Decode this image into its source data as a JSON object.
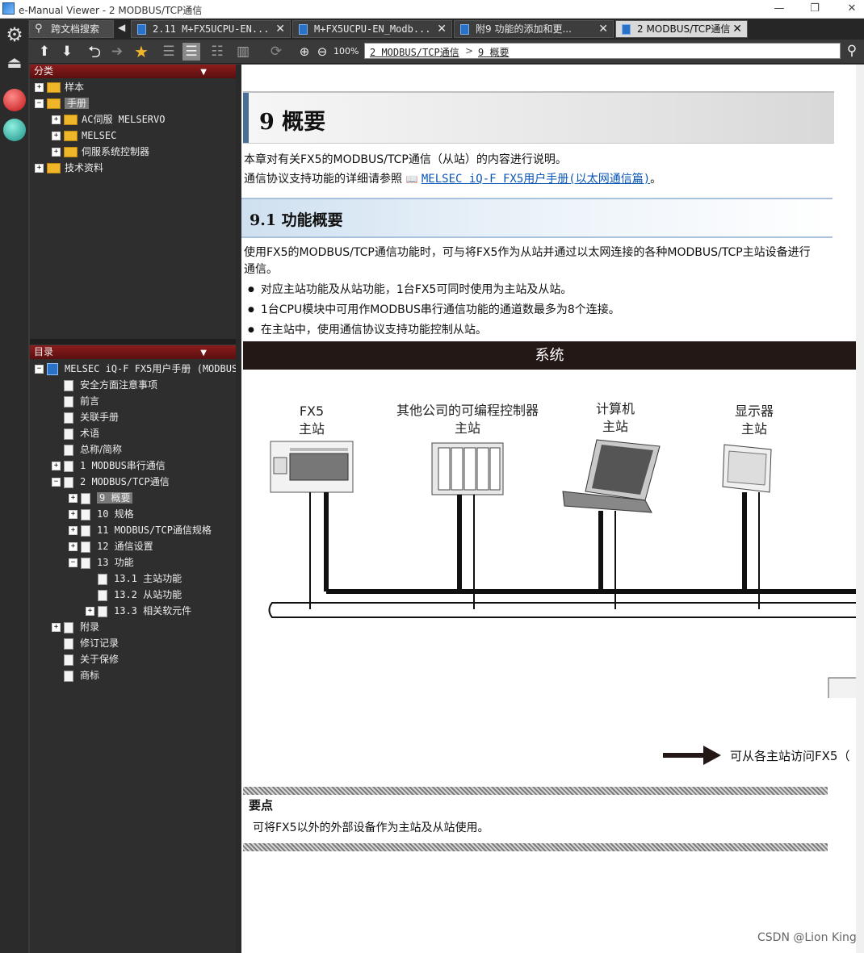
{
  "window": {
    "title": "e-Manual Viewer - 2 MODBUS/TCP通信",
    "min": "—",
    "max": "❐",
    "close": "✕"
  },
  "tabs": [
    {
      "label": "跨文档搜索"
    },
    {
      "label": "2.11 M+FX5UCPU-EN..."
    },
    {
      "label": "M+FX5UCPU-EN_Modb..."
    },
    {
      "label": "附9 功能的添加和更..."
    },
    {
      "label": "2 MODBUS/TCP通信"
    }
  ],
  "toolbar": {
    "zoom": "100%",
    "breadcrumb": [
      "2 MODBUS/TCP通信",
      ">",
      "9 概要"
    ]
  },
  "category_panel": {
    "title": "分类",
    "items": [
      {
        "label": "样本",
        "expander": "+"
      },
      {
        "label": "手册",
        "expander": "−"
      },
      {
        "label": "AC伺服 MELSERVO",
        "expander": "+"
      },
      {
        "label": "MELSEC",
        "expander": "+"
      },
      {
        "label": "伺服系统控制器",
        "expander": "+"
      },
      {
        "label": "技术资料",
        "expander": "+"
      }
    ]
  },
  "toc_panel": {
    "title": "目录",
    "items": [
      {
        "label": "MELSEC iQ-F FX5用户手册 (MODBUS",
        "expander": "−"
      },
      {
        "label": "安全方面注意事项"
      },
      {
        "label": "前言"
      },
      {
        "label": "关联手册"
      },
      {
        "label": "术语"
      },
      {
        "label": "总称/简称"
      },
      {
        "label": "1 MODBUS串行通信",
        "expander": "+"
      },
      {
        "label": "2 MODBUS/TCP通信",
        "expander": "−"
      },
      {
        "label": "9 概要",
        "expander": "+"
      },
      {
        "label": "10 规格",
        "expander": "+"
      },
      {
        "label": "11 MODBUS/TCP通信规格",
        "expander": "+"
      },
      {
        "label": "12 通信设置",
        "expander": "+"
      },
      {
        "label": "13 功能",
        "expander": "−"
      },
      {
        "label": "13.1 主站功能"
      },
      {
        "label": "13.2 从站功能"
      },
      {
        "label": "13.3 相关软元件",
        "expander": "+"
      },
      {
        "label": "附录",
        "expander": "+"
      },
      {
        "label": "修订记录"
      },
      {
        "label": "关于保修"
      },
      {
        "label": "商标"
      }
    ]
  },
  "content": {
    "chapter_title": "9 概要",
    "intro_1": "本章对有关FX5的MODBUS/TCP通信（从站）的内容进行说明。",
    "intro_2_prefix": "通信协议支持功能的详细请参照",
    "intro_2_link": "MELSEC iQ-F FX5用户手册(以太网通信篇)",
    "intro_2_suffix": "。",
    "section_title": "9.1 功能概要",
    "section_para_1": "使用FX5的MODBUS/TCP通信功能时，可与将FX5作为从站并通过以太网连接的各种MODBUS/TCP主站设备进行",
    "section_para_2": "通信。",
    "bullets": [
      "对应主站功能及从站功能，1台FX5可同时使用为主站及从站。",
      "1台CPU模块中可用作MODBUS串行通信功能的通道数最多为8个连接。",
      "在主站中，使用通信协议支持功能控制从站。"
    ],
    "system_label": "系统",
    "devices": [
      {
        "line1": "FX5",
        "line2": "主站"
      },
      {
        "line1": "其他公司的可编程控制器",
        "line2": "主站"
      },
      {
        "line1": "计算机",
        "line2": "主站"
      },
      {
        "line1": "显示器",
        "line2": "主站"
      }
    ],
    "arrow_text": "可从各主站访问FX5（",
    "point_title": "要点",
    "point_text": "可将FX5以外的外部设备作为主站及从站使用。"
  },
  "watermark": "CSDN @Lion King"
}
